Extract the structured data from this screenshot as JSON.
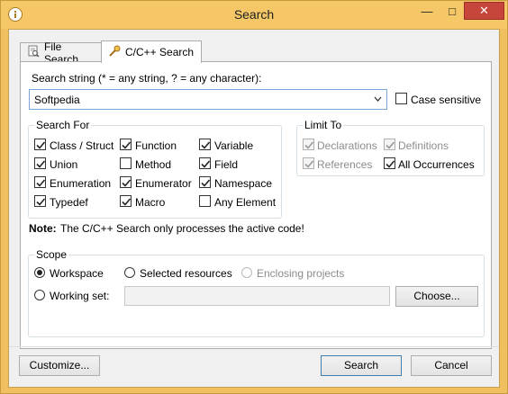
{
  "window": {
    "title": "Search",
    "controls": {
      "minimize": "—",
      "maximize": "□",
      "close": "✕"
    }
  },
  "tabs": [
    {
      "label": "File Search",
      "icon": "file-search-icon"
    },
    {
      "label": "C/C++ Search",
      "icon": "cpp-search-icon",
      "active": true
    }
  ],
  "search": {
    "label": "Search string (* = any string, ? = any character):",
    "value": "Softpedia",
    "case_sensitive_label": "Case sensitive",
    "case_sensitive": false
  },
  "search_for": {
    "title": "Search For",
    "items": [
      {
        "label": "Class / Struct",
        "checked": true
      },
      {
        "label": "Function",
        "checked": true
      },
      {
        "label": "Variable",
        "checked": true
      },
      {
        "label": "Union",
        "checked": true
      },
      {
        "label": "Method",
        "checked": false
      },
      {
        "label": "Field",
        "checked": true
      },
      {
        "label": "Enumeration",
        "checked": true
      },
      {
        "label": "Enumerator",
        "checked": true
      },
      {
        "label": "Namespace",
        "checked": true
      },
      {
        "label": "Typedef",
        "checked": true
      },
      {
        "label": "Macro",
        "checked": true
      },
      {
        "label": "Any Element",
        "checked": false
      }
    ]
  },
  "limit_to": {
    "title": "Limit To",
    "items": [
      {
        "label": "Declarations",
        "checked": true,
        "enabled": false
      },
      {
        "label": "Definitions",
        "checked": true,
        "enabled": false
      },
      {
        "label": "References",
        "checked": true,
        "enabled": false
      },
      {
        "label": "All Occurrences",
        "checked": true,
        "enabled": true
      }
    ]
  },
  "note": {
    "prefix": "Note:",
    "text": "The C/C++ Search only processes the active code!"
  },
  "scope": {
    "title": "Scope",
    "workspace": "Workspace",
    "selected_resources": "Selected resources",
    "enclosing_projects": "Enclosing projects",
    "working_set": "Working set:",
    "working_set_value": "",
    "choose": "Choose...",
    "selected": "workspace"
  },
  "footer": {
    "customize": "Customize...",
    "search": "Search",
    "cancel": "Cancel"
  },
  "colors": {
    "titlebar": "#f5c766",
    "close": "#c7463b",
    "focus_border": "#7aa7d8"
  }
}
